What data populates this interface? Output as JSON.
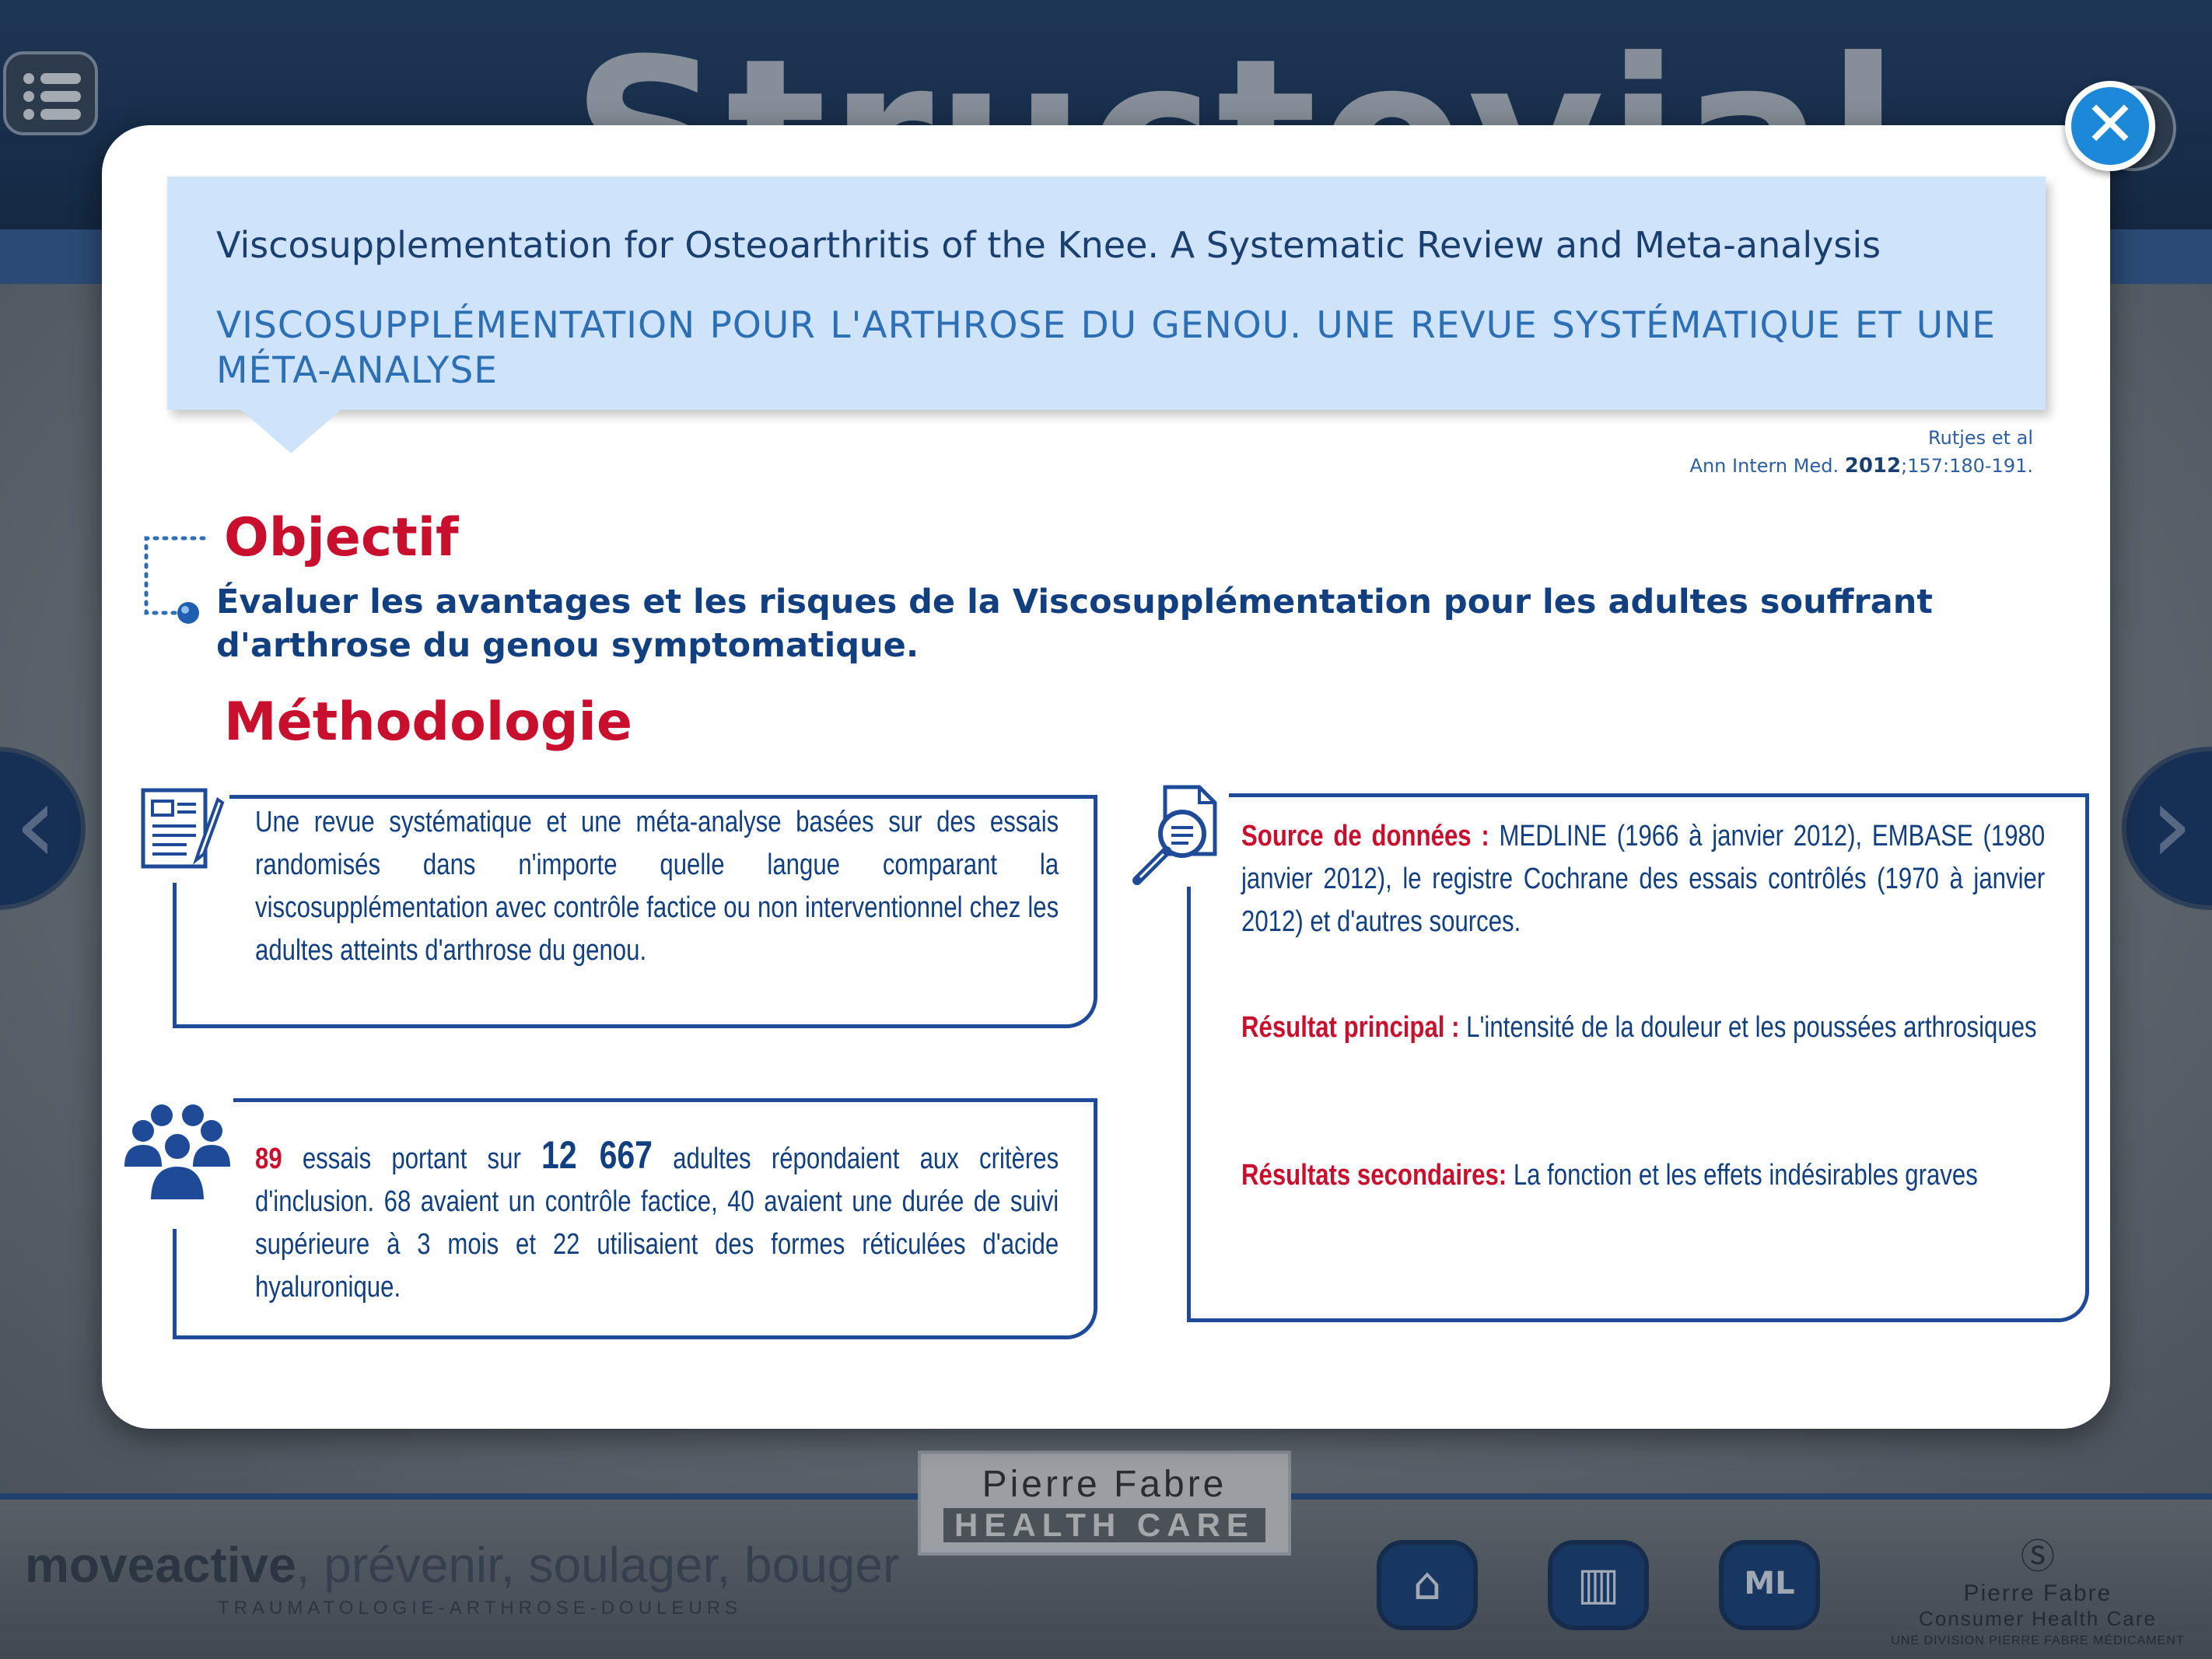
{
  "app": {
    "title": "Structovial",
    "add_label": "+",
    "prev_label": "‹",
    "next_label": "›"
  },
  "footer": {
    "brand_strong": "moveactive",
    "brand_tail": ", prévenir, soulager, bouger",
    "brand_sub": "TRAUMATOLOGIE-ARTHROSE-DOULEURS",
    "logo_name": "Pierre Fabre",
    "logo_hc": "HEALTH CARE",
    "home_icon": "⌂",
    "library_icon": "▥",
    "ml_label": "ML",
    "consumer_mark": "Ⓢ",
    "consumer_l1": "Pierre Fabre",
    "consumer_l2": "Consumer Health Care",
    "consumer_l3": "UNE DIVISION PIERRE FABRE MÉDICAMENT"
  },
  "modal": {
    "close_label": "✕",
    "title_en": "Viscosupplementation for Osteoarthritis of the Knee. A Systematic Review and Meta-analysis",
    "title_fr": "VISCOSUPPLÉMENTATION POUR L'ARTHROSE DU GENOU. UNE REVUE SYSTÉMATIQUE ET UNE MÉTA-ANALYSE",
    "citation_authors": "Rutjes et al",
    "citation_journal": "Ann Intern Med. ",
    "citation_year": "2012",
    "citation_ref": ";157:180-191.",
    "objectif_title": "Objectif",
    "objectif_text": "Évaluer les avantages et les risques de la Viscosupplémentation pour les adultes souffrant d'arthrose du genou symptomatique.",
    "methodologie_title": "Méthodologie",
    "box1_text": "Une revue systématique et une méta-analyse basées sur des essais randomisés dans n'importe quelle langue comparant la viscosupplémentation avec contrôle factice ou non interventionnel chez les adultes atteints d'arthrose du genou.",
    "box2_n_trials": "89",
    "box2_t1": " essais portant sur ",
    "box2_n_adults": "12 667",
    "box2_t2": " adultes répondaient aux critères d'inclusion. 68 avaient un contrôle factice, 40 avaient une durée de suivi supérieure à 3 mois et 22 utilisaient des formes réticulées d'acide hyaluronique.",
    "box3_source_label": "Source de données : ",
    "box3_source_text": "MEDLINE (1966 à janvier 2012), EMBASE (1980 janvier 2012), le registre Cochrane des essais contrôlés (1970 à janvier 2012) et d'autres sources.",
    "box3_main_label": "Résultat principal : ",
    "box3_main_text": "L'intensité de la douleur et les poussées arthrosiques",
    "box3_secondary_label": "Résultats secondaires: ",
    "box3_secondary_text": " La fonction et les effets indésirables graves"
  },
  "colors": {
    "accent_red": "#c8102e",
    "text_blue": "#123f80",
    "card_blue": "#cfe4fb",
    "close_blue": "#1e88d8"
  }
}
